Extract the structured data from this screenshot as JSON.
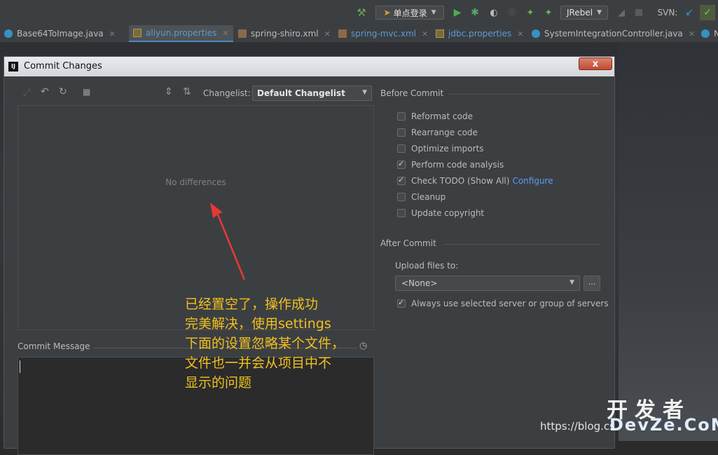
{
  "toolbar": {
    "run_config": "单点登录",
    "jrebel": "JRebel",
    "svn_label": "SVN:"
  },
  "tabs": [
    {
      "label": "Base64ToImage.java",
      "icon": "class-icon"
    },
    {
      "label": "aliyun.properties",
      "icon": "properties-icon"
    },
    {
      "label": "spring-shiro.xml",
      "icon": "xml-icon"
    },
    {
      "label": "spring-mvc.xml",
      "icon": "xml-icon"
    },
    {
      "label": "jdbc.properties",
      "icon": "properties-icon"
    },
    {
      "label": "SystemIntegrationController.java",
      "icon": "class-icon"
    },
    {
      "label": "N",
      "icon": "class-icon"
    }
  ],
  "dialog": {
    "title": "Commit Changes",
    "close": "x",
    "changelist_label": "Changelist:",
    "changelist_value": "Default Changelist",
    "no_differences": "No differences",
    "commit_message_label": "Commit Message",
    "before_commit": {
      "title": "Before Commit",
      "options": [
        {
          "label": "Reformat code",
          "checked": false
        },
        {
          "label": "Rearrange code",
          "checked": false
        },
        {
          "label": "Optimize imports",
          "checked": false
        },
        {
          "label": "Perform code analysis",
          "checked": true
        },
        {
          "label": "Check TODO (Show All)",
          "checked": true,
          "link": "Configure"
        },
        {
          "label": "Cleanup",
          "checked": false
        },
        {
          "label": "Update copyright",
          "checked": false
        }
      ]
    },
    "after_commit": {
      "title": "After Commit",
      "upload_label": "Upload files to:",
      "server_value": "<None>",
      "browse": "...",
      "always_use": {
        "label": "Always use selected server or group of servers",
        "checked": true
      }
    }
  },
  "annotation": {
    "lines": [
      "已经置空了，操作成功",
      "完美解决，使用settings",
      "下面的设置忽略某个文件，",
      "文件也一并会从项目中不",
      "显示的问题"
    ],
    "color": "#f0c020"
  },
  "watermark": {
    "url": "https://blog.cs",
    "brand_cn": "开发者",
    "brand_en": "DevZe.CoM"
  }
}
